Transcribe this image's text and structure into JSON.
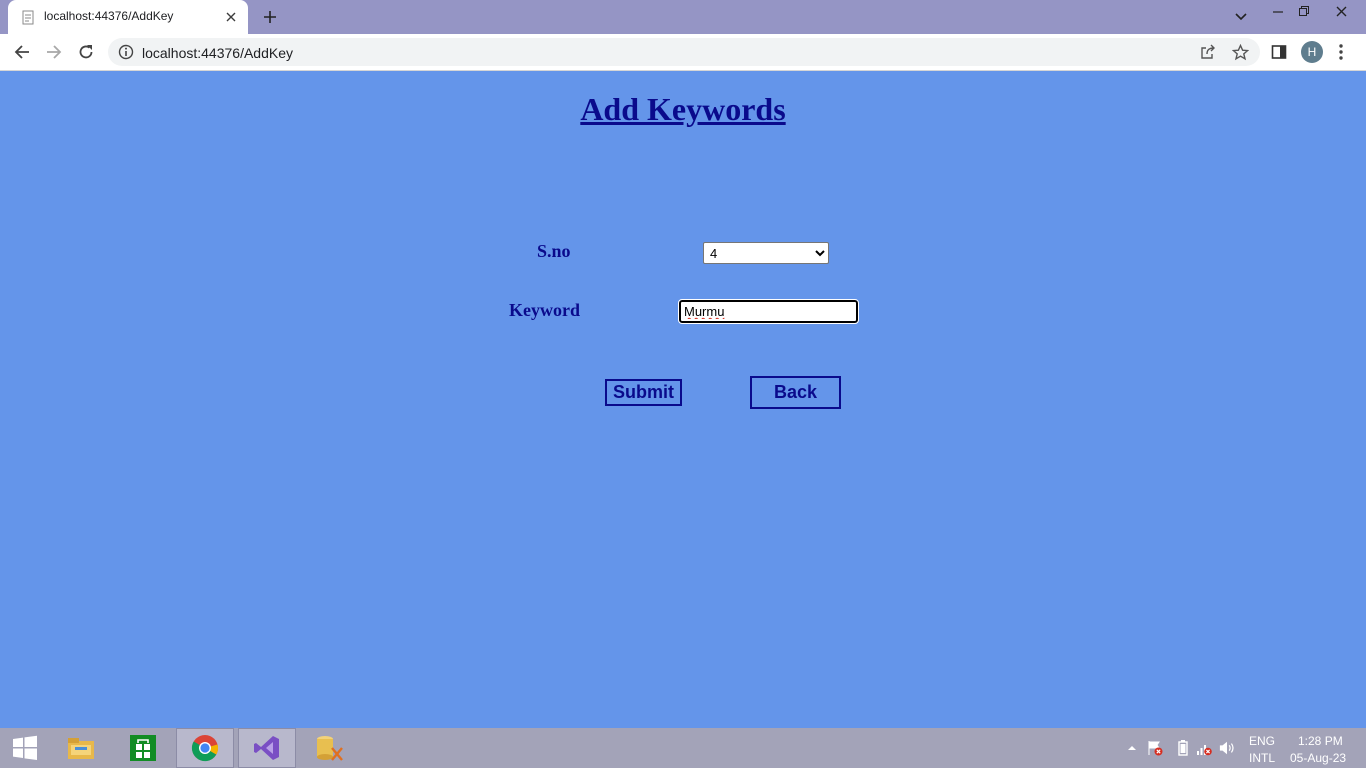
{
  "browser": {
    "tab_title": "localhost:44376/AddKey",
    "url": "localhost:44376/AddKey",
    "profile_initial": "H",
    "icons": [
      "page-favicon",
      "close-icon",
      "plus-icon",
      "chevron-down-icon",
      "minimize-icon",
      "restore-icon",
      "back-arrow-icon",
      "forward-arrow-icon",
      "reload-icon",
      "info-icon",
      "share-icon",
      "star-icon",
      "side-panel-icon",
      "kebab-menu-icon"
    ]
  },
  "page": {
    "title": "Add Keywords",
    "sno_label": "S.no",
    "sno_value": "4",
    "keyword_label": "Keyword",
    "keyword_value": "Murmu",
    "submit_label": "Submit",
    "back_label": "Back"
  },
  "taskbar": {
    "apps": [
      "windows-start",
      "file-explorer",
      "store",
      "chrome",
      "visual-studio",
      "sql-tool"
    ],
    "lang_line1": "ENG",
    "lang_line2": "INTL",
    "time": "1:28 PM",
    "date": "05-Aug-23"
  },
  "colors": {
    "page_background": "#6495ea",
    "heading_text": "#0a0a8c",
    "titlebar": "#9595c5",
    "taskbar": "#a3a3b8"
  }
}
